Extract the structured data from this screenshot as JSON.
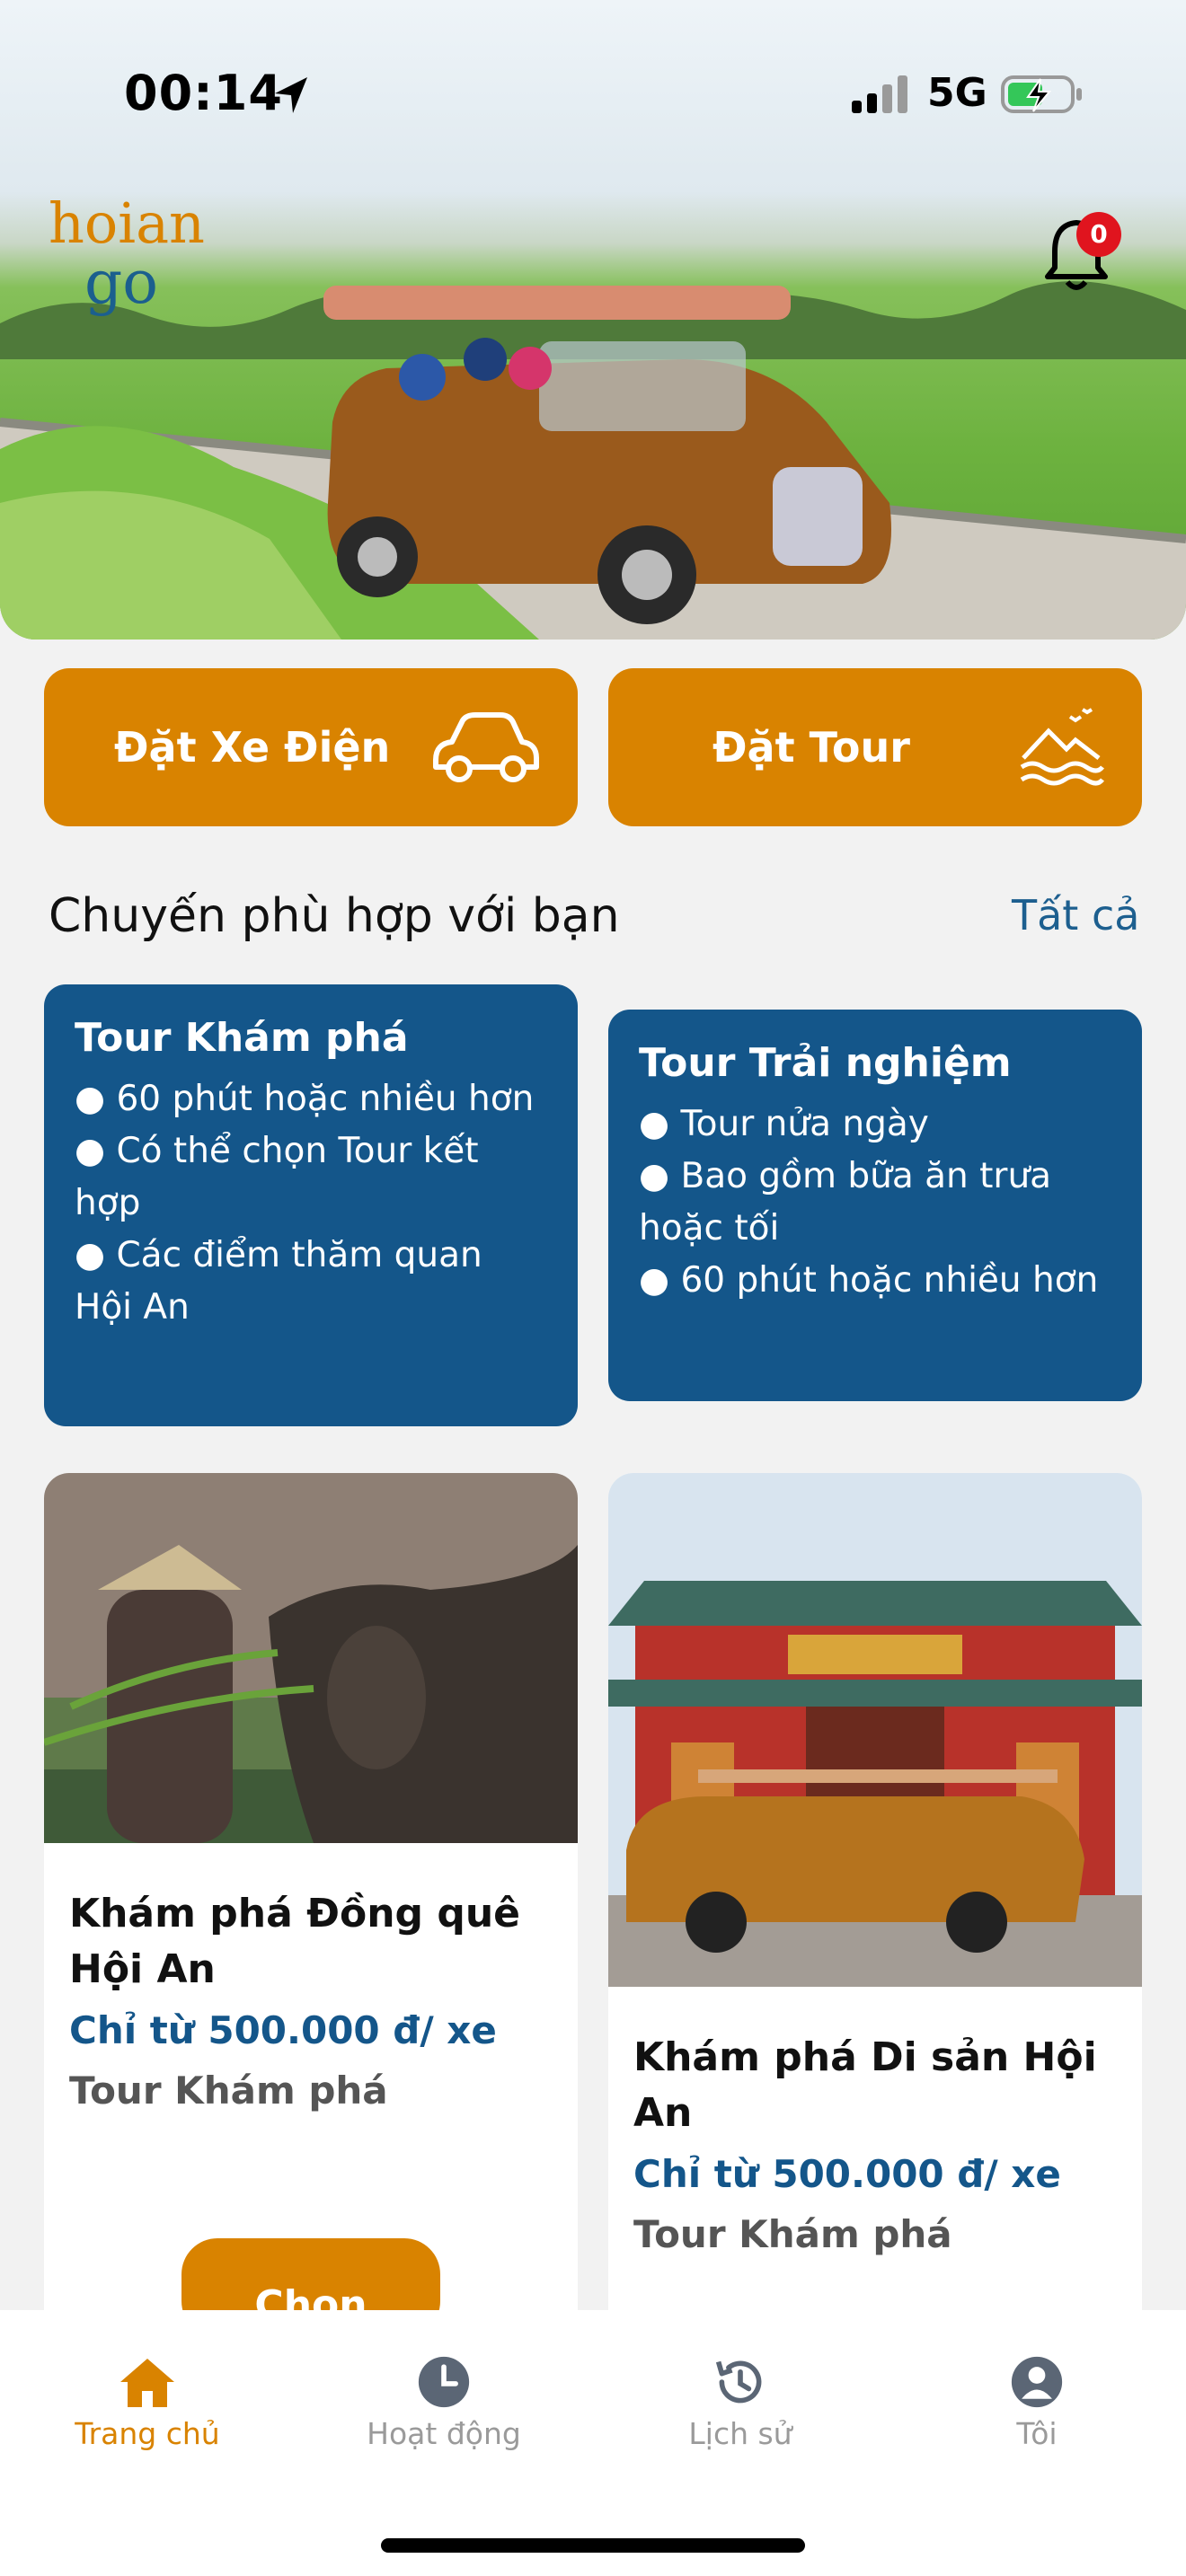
{
  "status_bar": {
    "time": "00:14",
    "network": "5G"
  },
  "app": {
    "logo_top": "hoian",
    "logo_bottom": "go",
    "notification_count": "0",
    "brand_color": "#d98300",
    "accent_blue": "#14568a"
  },
  "actions": {
    "book_electric_car": "Đặt Xe Điện",
    "book_tour": "Đặt Tour"
  },
  "section": {
    "title": "Chuyến phù hợp với bạn",
    "see_all": "Tất cả"
  },
  "tour_types": [
    {
      "title": "Tour Khám phá",
      "items": [
        "60 phút hoặc nhiều hơn",
        "Có thể chọn Tour kết hợp",
        "Các điểm thăm quan Hội An"
      ]
    },
    {
      "title": "Tour Trải nghiệm",
      "items": [
        "Tour nửa ngày",
        "Bao gồm bữa ăn trưa hoặc tối",
        "60 phút hoặc nhiều hơn"
      ]
    }
  ],
  "tours": [
    {
      "title": "Khám phá Đồng quê Hội An",
      "price": "Chỉ từ 500.000 đ/ xe",
      "category": "Tour Khám phá",
      "button": "Chọn"
    },
    {
      "title": "Khám phá Di sản Hội An",
      "price": "Chỉ từ 500.000 đ/ xe",
      "category": "Tour Khám phá"
    }
  ],
  "tabs": [
    {
      "label": "Trang chủ",
      "icon": "home-icon",
      "active": true
    },
    {
      "label": "Hoạt động",
      "icon": "clock-icon"
    },
    {
      "label": "Lịch sử",
      "icon": "history-icon"
    },
    {
      "label": "Tôi",
      "icon": "user-icon"
    }
  ]
}
